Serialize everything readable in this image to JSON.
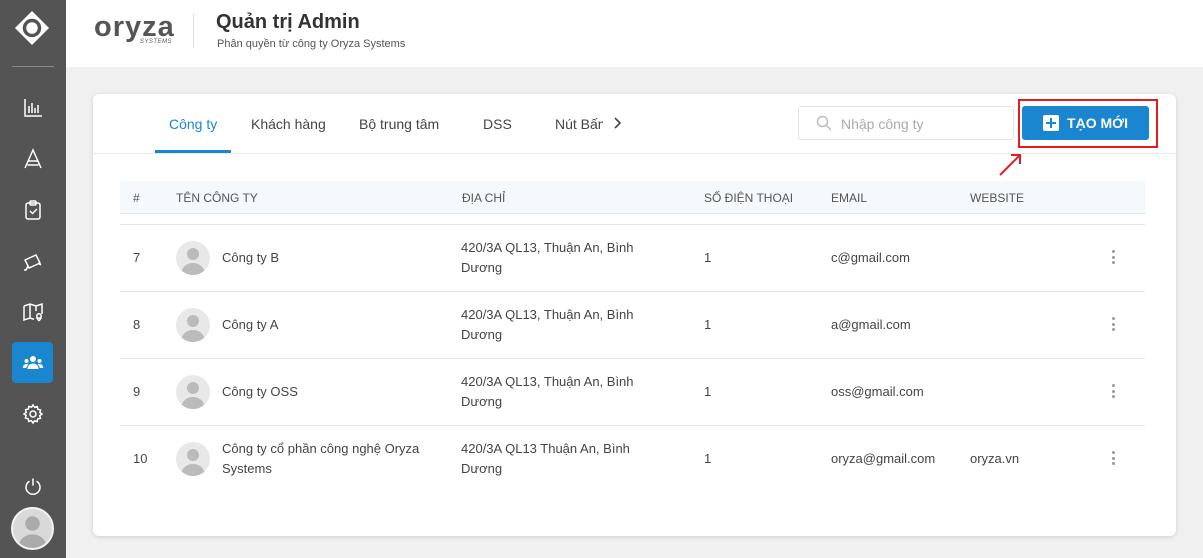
{
  "header": {
    "brand_name": "oryza",
    "brand_sub": "SYSTEMS",
    "title": "Quản trị Admin",
    "subtitle": "Phân quyền từ công ty Oryza Systems"
  },
  "tabs": [
    {
      "label": "Công ty",
      "active": true
    },
    {
      "label": "Khách hàng",
      "active": false
    },
    {
      "label": "Bộ trung tâm",
      "active": false
    },
    {
      "label": "DSS",
      "active": false
    },
    {
      "label": "Nút Bấm",
      "active": false
    }
  ],
  "search": {
    "placeholder": "Nhập công ty",
    "value": ""
  },
  "create_button": {
    "label": "TẠO MỚI"
  },
  "table": {
    "headers": [
      "#",
      "TÊN CÔNG TY",
      "ĐỊA CHỈ",
      "SỐ ĐIỆN THOẠI",
      "EMAIL",
      "WEBSITE"
    ],
    "rows": [
      {
        "id": "7",
        "name": "Công ty B",
        "address": "420/3A QL13, Thuận An, Bình Dương",
        "phone": "1",
        "email": "c@gmail.com",
        "website": ""
      },
      {
        "id": "8",
        "name": "Công ty A",
        "address": "420/3A QL13, Thuận An, Bình Dương",
        "phone": "1",
        "email": "a@gmail.com",
        "website": ""
      },
      {
        "id": "9",
        "name": "Công ty OSS",
        "address": "420/3A QL13, Thuận An, Bình Dương",
        "phone": "1",
        "email": "oss@gmail.com",
        "website": ""
      },
      {
        "id": "10",
        "name": "Công ty cổ phần công nghệ Oryza Systems",
        "address": "420/3A QL13 Thuận An, Bình Dương",
        "phone": "1",
        "email": "oryza@gmail.com",
        "website": "oryza.vn"
      }
    ]
  },
  "sidebar": {
    "items": [
      {
        "icon": "bar-chart-icon",
        "active": false
      },
      {
        "icon": "text-a-icon",
        "active": false
      },
      {
        "icon": "clipboard-check-icon",
        "active": false
      },
      {
        "icon": "camera-icon",
        "active": false
      },
      {
        "icon": "map-pin-icon",
        "active": false
      },
      {
        "icon": "users-icon",
        "active": true
      },
      {
        "icon": "gear-icon",
        "active": false
      },
      {
        "icon": "power-icon",
        "active": false
      }
    ]
  },
  "colors": {
    "accent": "#1a86d0",
    "highlight": "#e01e1e",
    "sidebar": "#545454"
  }
}
